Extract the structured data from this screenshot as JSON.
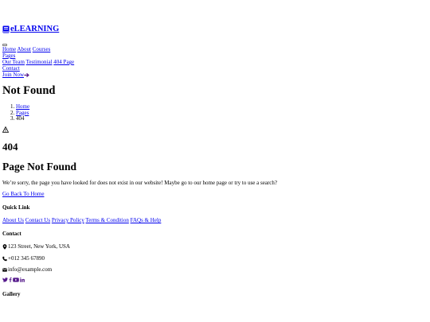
{
  "brand": {
    "name": "eLEARNING"
  },
  "nav": {
    "row1": [
      "Home",
      "About",
      "Courses"
    ],
    "pages_label": "Pages",
    "row3": [
      "Our Team",
      "Testimonial",
      "404 Page"
    ],
    "contact": "Contact",
    "join": "Join Now"
  },
  "header": {
    "title": "Not Found",
    "breadcrumb": [
      "Home",
      "Pages",
      "404"
    ]
  },
  "error": {
    "code": "404",
    "title": "Page Not Found",
    "message": "We’re sorry, the page you have looked for does not exist in our website! Maybe go to our home page or try to use a search?",
    "back_label": "Go Back To Home"
  },
  "footer": {
    "quick_link_heading": "Quick Link",
    "quick_links": [
      "About Us",
      "Contact Us",
      "Privacy Policy",
      "Terms & Condition",
      "FAQs & Help"
    ],
    "contact_heading": "Contact",
    "address": "123 Street, New York, USA",
    "phone": "+012 345 67890",
    "email": "info@example.com",
    "gallery_heading": "Gallery"
  },
  "colors": {
    "link": "#0000ee",
    "icon": "#551a8b",
    "text": "#000000"
  },
  "icons": [
    "book-icon",
    "arrow-right-icon",
    "warning-icon",
    "map-marker-icon",
    "phone-icon",
    "envelope-icon",
    "twitter-icon",
    "facebook-icon",
    "youtube-icon",
    "linkedin-icon"
  ]
}
